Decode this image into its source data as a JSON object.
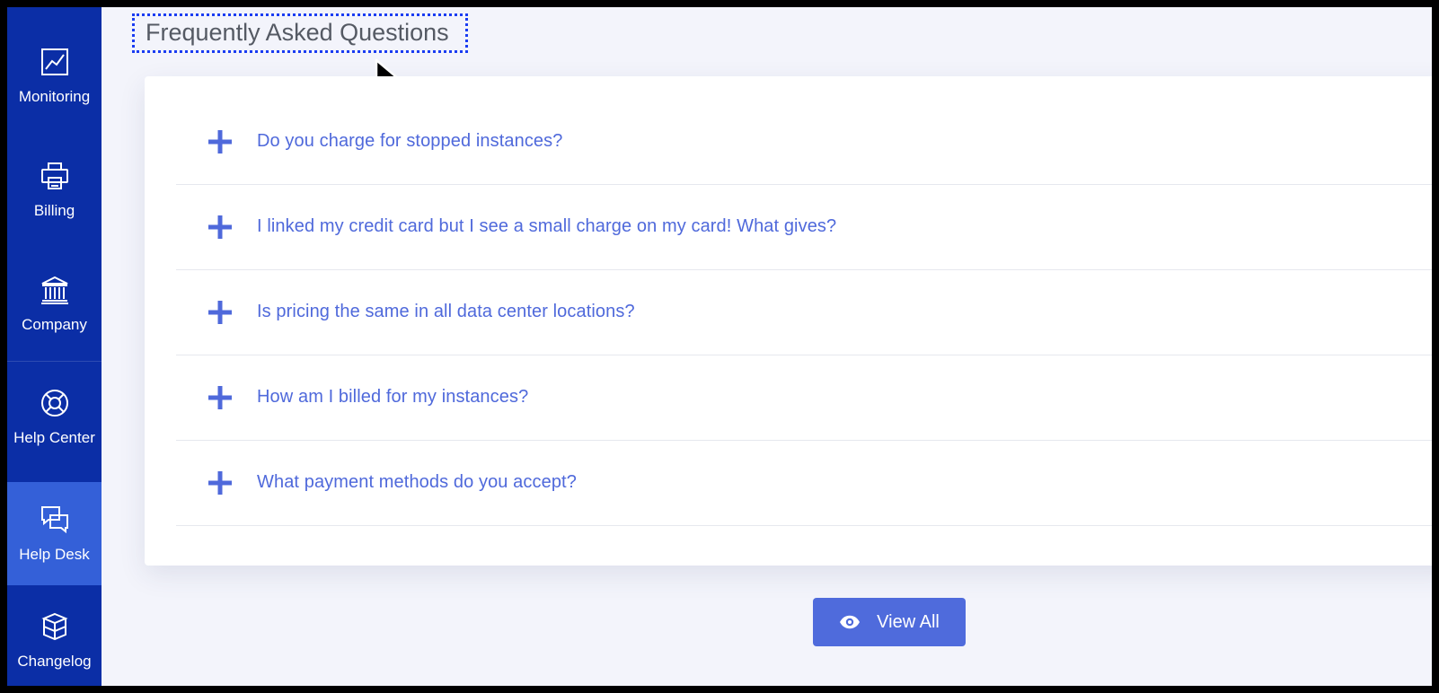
{
  "sidebar": {
    "items": [
      {
        "label": "Monitoring",
        "icon": "chart-line-icon"
      },
      {
        "label": "Billing",
        "icon": "printer-icon"
      },
      {
        "label": "Company",
        "icon": "bank-icon"
      },
      {
        "label": "Help Center",
        "icon": "lifebuoy-icon"
      },
      {
        "label": "Help Desk",
        "icon": "chat-bubbles-icon",
        "active": true
      },
      {
        "label": "Changelog",
        "icon": "cubes-icon"
      }
    ]
  },
  "faq": {
    "title": "Frequently Asked Questions",
    "questions": [
      "Do you charge for stopped instances?",
      "I linked my credit card but I see a small charge on my card! What gives?",
      "Is pricing the same in all data center locations?",
      "How am I billed for my instances?",
      "What payment methods do you accept?"
    ],
    "view_all_label": "View All"
  },
  "colors": {
    "sidebar": "#0b2ea6",
    "sidebar_active": "#3460d8",
    "accent": "#4f69db",
    "background": "#f3f4fb"
  }
}
